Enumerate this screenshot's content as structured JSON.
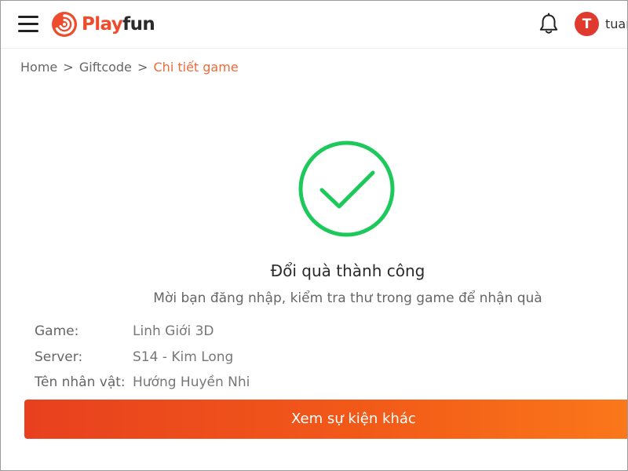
{
  "header": {
    "logo_text_play": "Play",
    "logo_text_fun": "fun",
    "avatar_initial": "T",
    "username": "tuan"
  },
  "breadcrumb": {
    "items": [
      "Home",
      "Giftcode",
      "Chi tiết game"
    ],
    "separator": ">"
  },
  "result": {
    "title": "Đổi quà thành công",
    "subtitle": "Mời bạn đăng nhập, kiểm tra thư trong game để nhận quà"
  },
  "details": [
    {
      "label": "Game:",
      "value": "Linh Giới 3D"
    },
    {
      "label": "Server:",
      "value": "S14 - Kim Long"
    },
    {
      "label": "Tên nhân vật:",
      "value": "Hướng Huyền Nhi"
    }
  ],
  "cta": {
    "label": "Xem sự kiện khác"
  },
  "colors": {
    "brand": "#ee4d2d",
    "success": "#1ec95b",
    "avatar": "#e03a2f",
    "cta_start": "#e8401f",
    "cta_end": "#fb7a1a"
  },
  "icons": {
    "menu": "hamburger-menu-icon",
    "logo": "playfun-logo-icon",
    "notification": "bell-icon",
    "success": "check-circle-icon"
  }
}
